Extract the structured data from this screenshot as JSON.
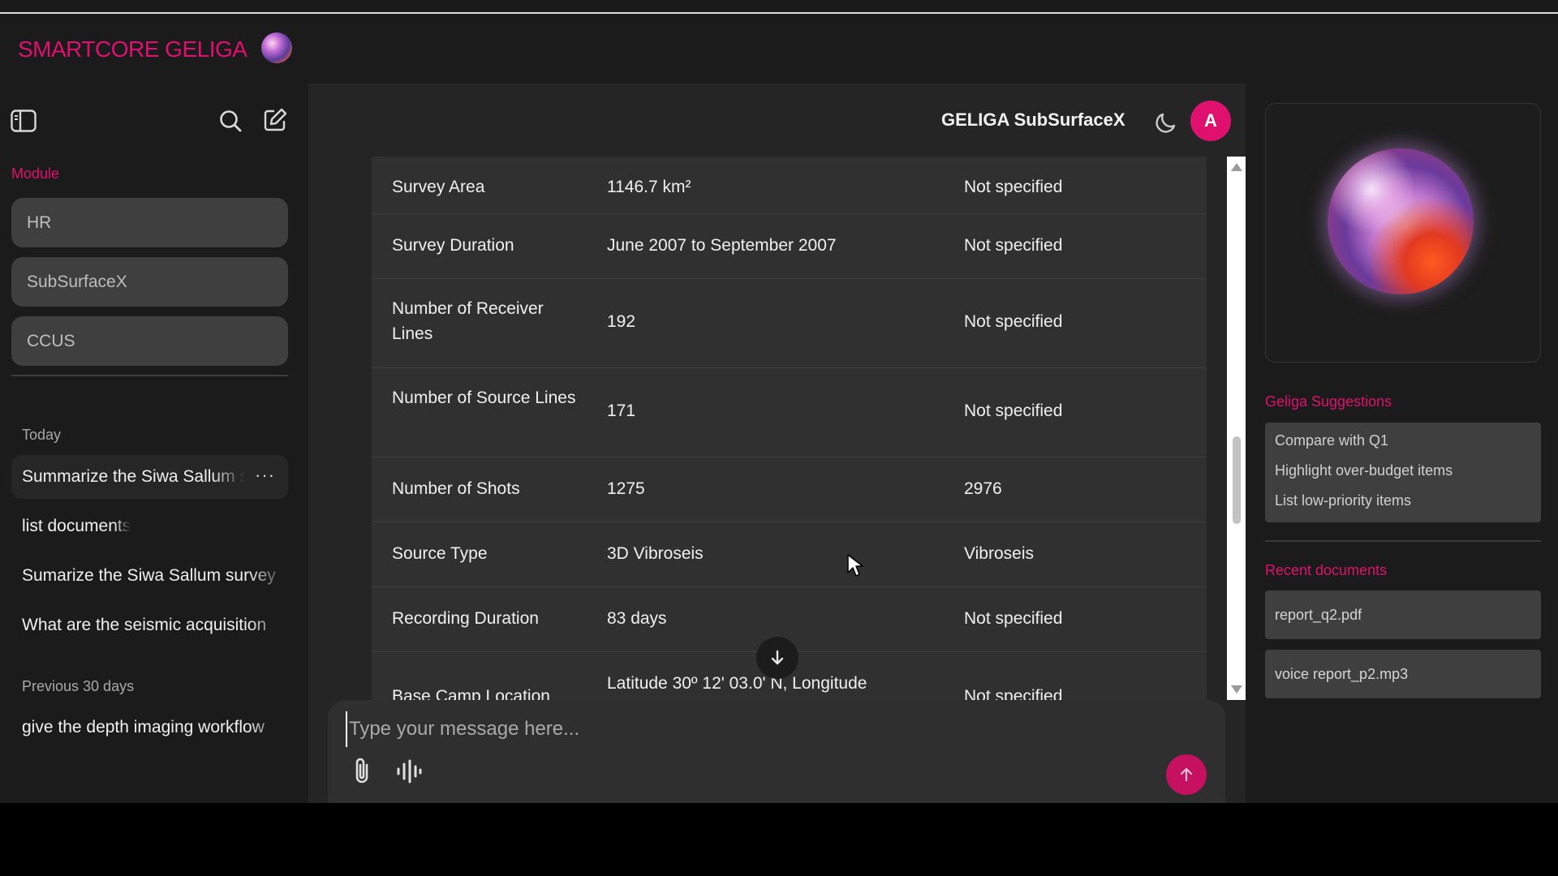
{
  "brand": {
    "name": "SMARTCORE GELIGA",
    "color": "#e0116e"
  },
  "sidebar": {
    "icons": [
      "sidebar-toggle-icon",
      "search-icon",
      "new-chat-icon"
    ],
    "module_label": "Module",
    "modules": [
      {
        "label": "HR"
      },
      {
        "label": "SubSurfaceX"
      },
      {
        "label": "CCUS"
      }
    ],
    "today_label": "Today",
    "today_items": [
      {
        "label": "Summarize the Siwa Sallum survey",
        "menu": "···"
      },
      {
        "label": "list documents"
      },
      {
        "label": "Sumarize the Siwa Sallum survey"
      },
      {
        "label": "What are the seismic acquisition"
      }
    ],
    "prev_label": "Previous 30 days",
    "prev_items": [
      {
        "label": "give the depth imaging workflow"
      }
    ]
  },
  "main": {
    "title": "GELIGA SubSurfaceX",
    "avatar_letter": "A",
    "table": {
      "rows": [
        {
          "param": "Survey Area",
          "value": "1146.7 km²",
          "other": "Not specified"
        },
        {
          "param": "Survey Duration",
          "value": "June 2007 to September 2007",
          "other": "Not specified"
        },
        {
          "param": "Number of Receiver Lines",
          "value": "192",
          "other": "Not specified"
        },
        {
          "param": "Number of Source Lines",
          "value": "171",
          "other": "Not specified"
        },
        {
          "param": "Number of Shots",
          "value": "1275",
          "other": "2976"
        },
        {
          "param": "Source Type",
          "value": "3D Vibroseis",
          "other": "Vibroseis"
        },
        {
          "param": "Recording Duration",
          "value": "83 days",
          "other": "Not specified"
        },
        {
          "param": "Base Camp Location",
          "value": "Latitude 30º 12' 03.0' N, Longitude",
          "other": "Not specified"
        }
      ]
    },
    "composer": {
      "placeholder": "Type your message here..."
    }
  },
  "right_panel": {
    "suggestions_label": "Geliga Suggestions",
    "suggestions": [
      "Compare with Q1",
      "Highlight over-budget items",
      "List low-priority items"
    ],
    "recent_label": "Recent documents",
    "recent_docs": [
      "report_q2.pdf",
      "voice report_p2.mp3"
    ]
  },
  "colors": {
    "accent": "#e0116e",
    "send": "#c51160",
    "panel": "#1b1b1b",
    "main": "#252525",
    "table": "#303030"
  }
}
